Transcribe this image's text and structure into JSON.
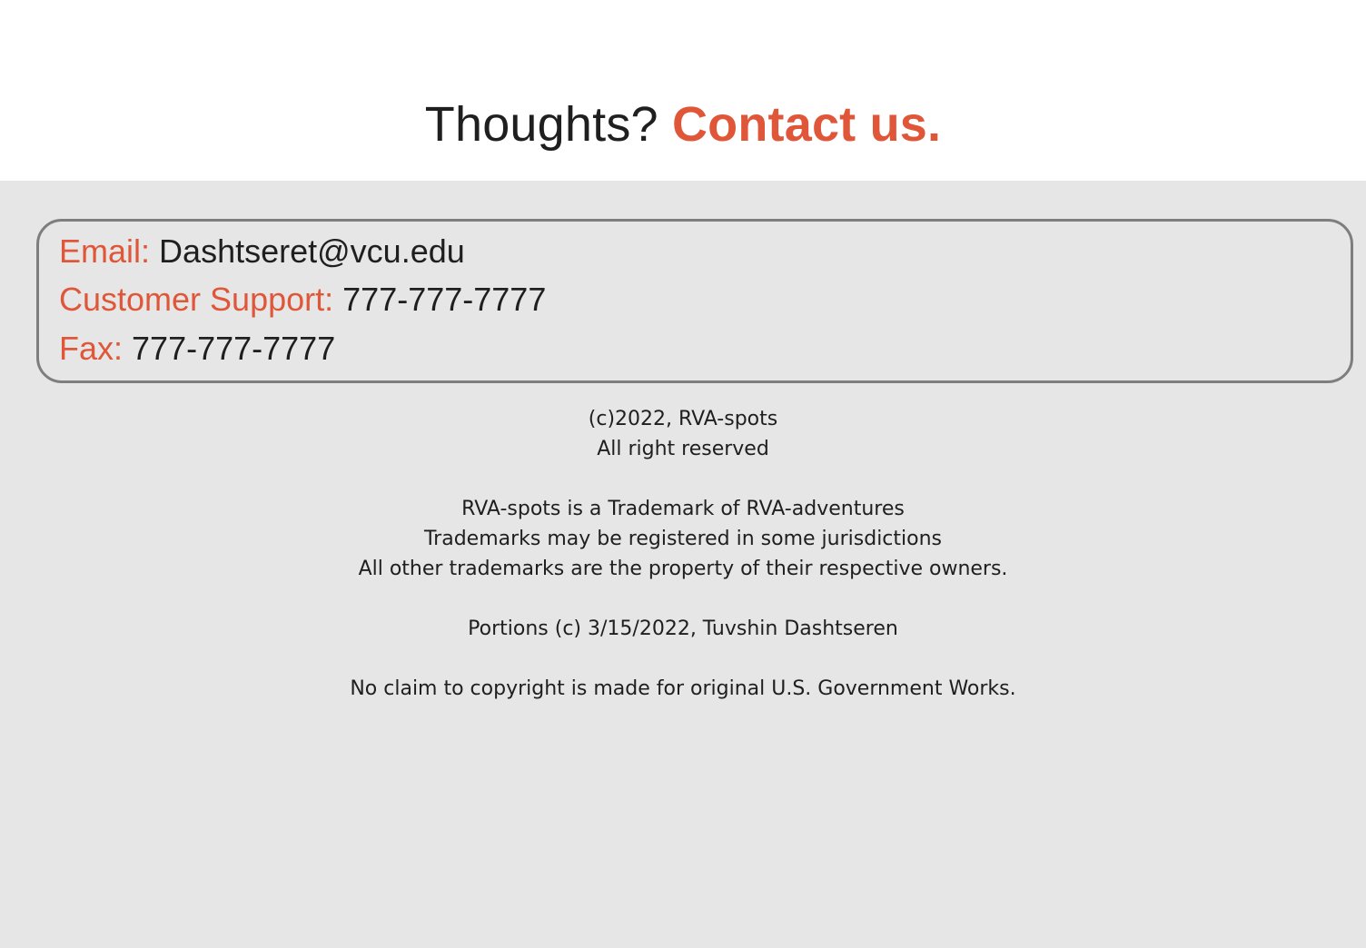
{
  "hero": {
    "question": "Thoughts?",
    "cta": "Contact us."
  },
  "contact": {
    "email_label": "Email:",
    "email_value": "Dashtseret@vcu.edu",
    "support_label": "Customer Support:",
    "support_value": "777-777-7777",
    "fax_label": "Fax:",
    "fax_value": "777-777-7777"
  },
  "legal": {
    "copyright": "(c)2022, RVA-spots",
    "rights": "All right reserved",
    "trademark_1": "RVA-spots is a Trademark of RVA-adventures",
    "trademark_2": "Trademarks may be registered in some jurisdictions",
    "trademark_3": "All other trademarks are the property of their respective owners.",
    "portions": "Portions (c) 3/15/2022, Tuvshin Dashtseren",
    "gov_notice": "No claim to copyright is made for original U.S. Government Works."
  },
  "colors": {
    "accent": "#e05638",
    "text": "#1f1f1f",
    "footer_bg": "#e6e6e6",
    "box_border": "#7e7e7e"
  }
}
